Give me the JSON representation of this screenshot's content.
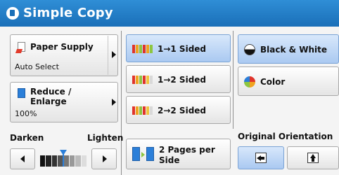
{
  "header": {
    "title": "Simple Copy",
    "icon": "copy-icon"
  },
  "paper_supply": {
    "label": "Paper Supply",
    "value": "Auto Select"
  },
  "reduce_enlarge": {
    "label_line1": "Reduce /",
    "label_line2": "Enlarge",
    "value": "100%"
  },
  "density": {
    "darken_label": "Darken",
    "lighten_label": "Lighten",
    "level": 0.5
  },
  "sides": {
    "one_to_one": "1→1 Sided",
    "one_to_two": "1→2 Sided",
    "two_to_two": "2→2 Sided"
  },
  "pages_per_side": {
    "line1": "2 Pages per",
    "line2": "Side"
  },
  "color_mode": {
    "black_white": "Black & White",
    "color": "Color"
  },
  "orientation": {
    "label": "Original Orientation"
  },
  "colors": {
    "title_bar": "#1a6fb8",
    "selected": "#aac9f1"
  }
}
